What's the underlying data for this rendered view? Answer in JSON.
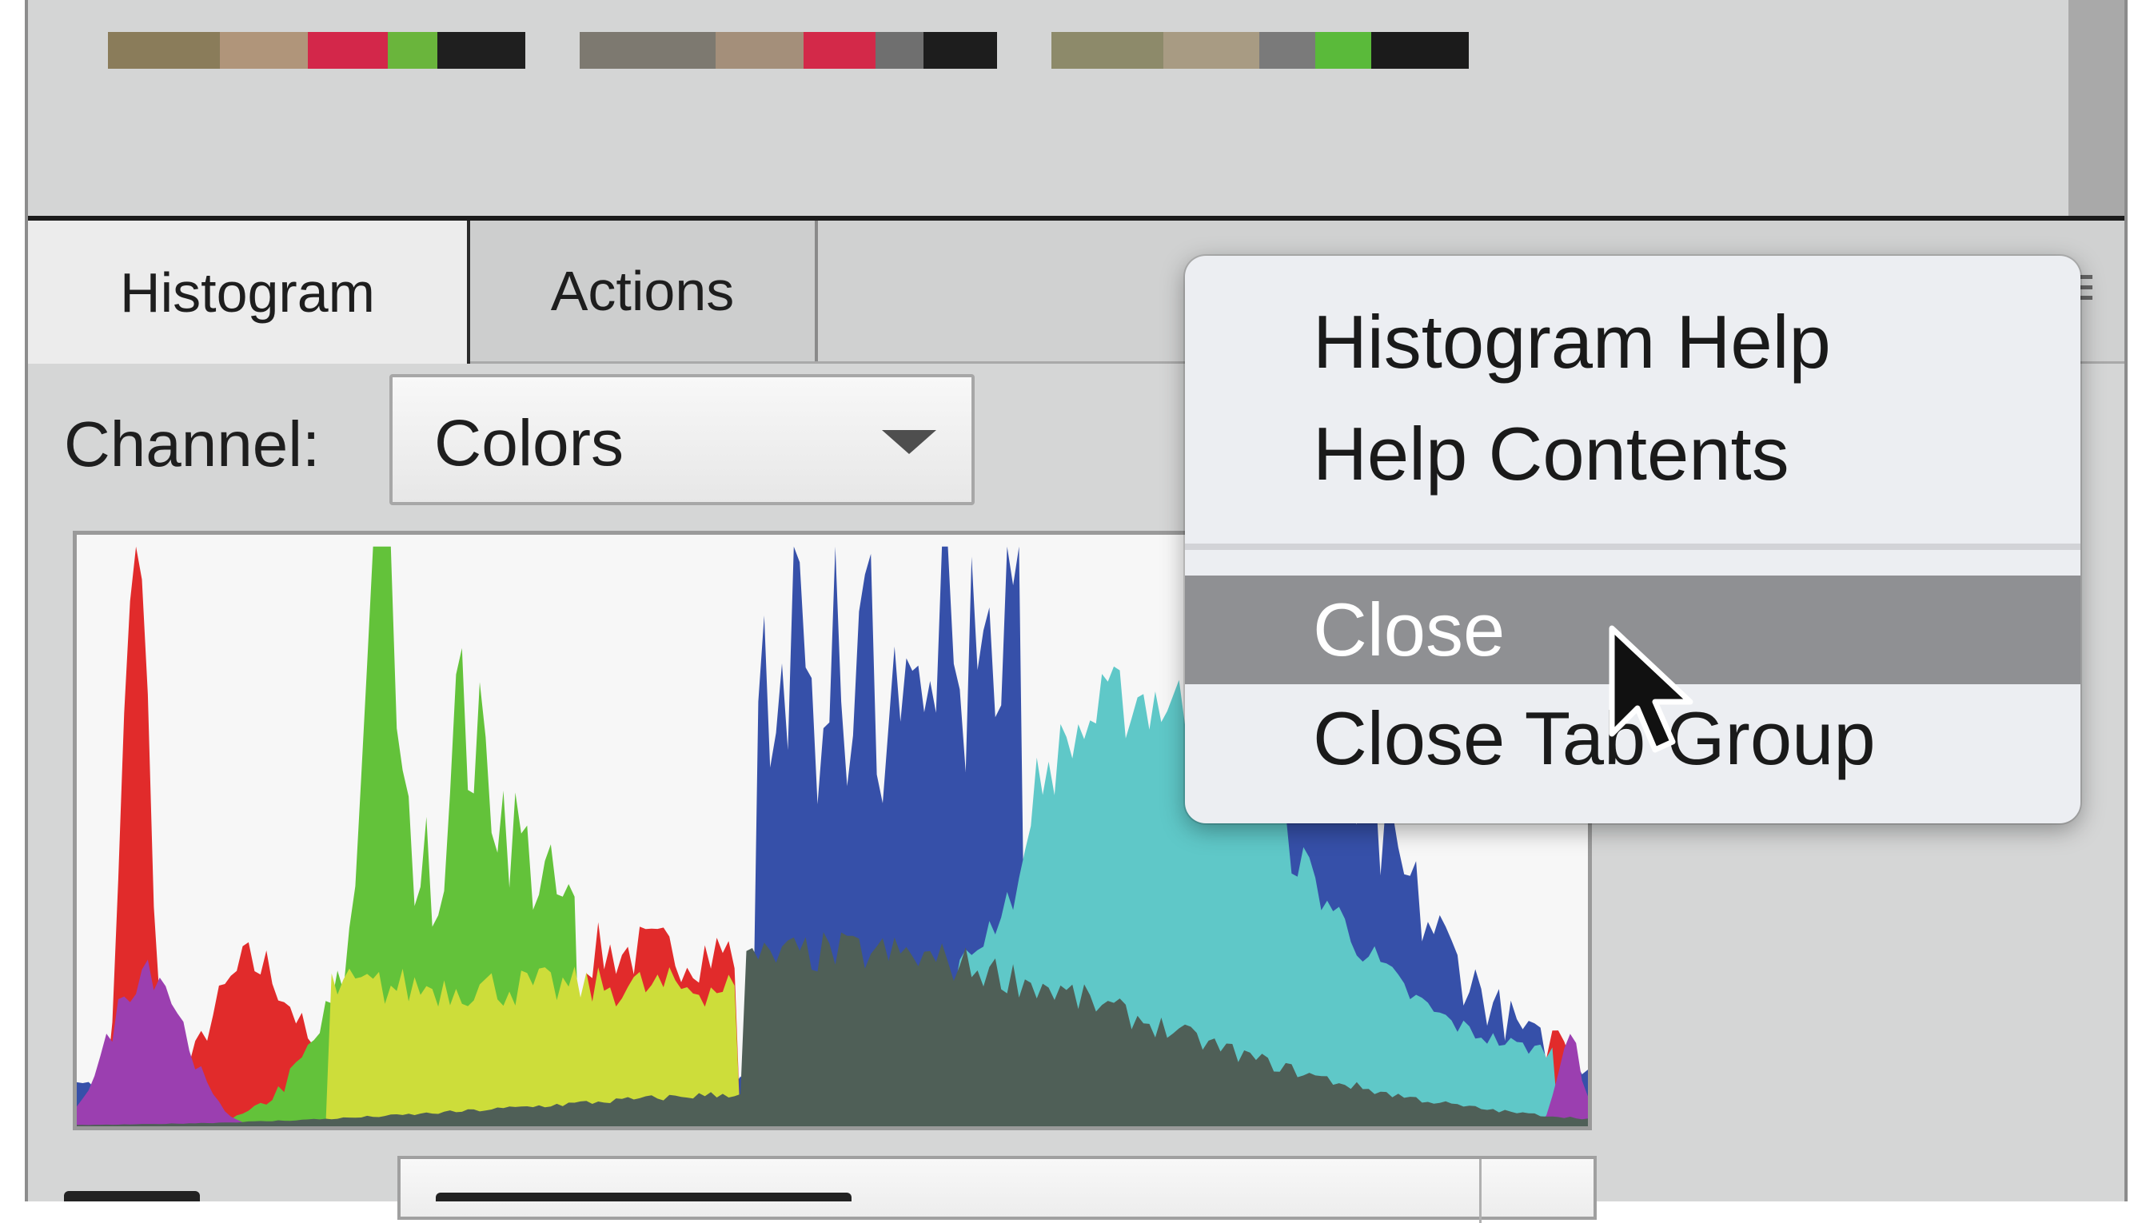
{
  "tabs": [
    {
      "label": "Histogram",
      "active": true
    },
    {
      "label": "Actions",
      "active": false
    }
  ],
  "channel": {
    "label": "Channel:",
    "value": "Colors"
  },
  "context_menu": {
    "items": [
      {
        "label": "Histogram Help",
        "highlighted": false
      },
      {
        "label": "Help Contents",
        "highlighted": false
      },
      {
        "label": "Close",
        "highlighted": true
      },
      {
        "label": "Close Tab Group",
        "highlighted": false
      }
    ]
  },
  "colors": {
    "red": "#e12b2b",
    "green": "#63c23a",
    "blue": "#3650a9",
    "cyan": "#5fc8c8",
    "yellow": "#cddd3a",
    "magenta": "#9b3fb0",
    "gray": "#4f5f57",
    "menu_highlight": "#8f9093"
  },
  "icons": [
    "dropdown-arrow-icon",
    "panel-menu-icon",
    "mouse-cursor-icon"
  ]
}
